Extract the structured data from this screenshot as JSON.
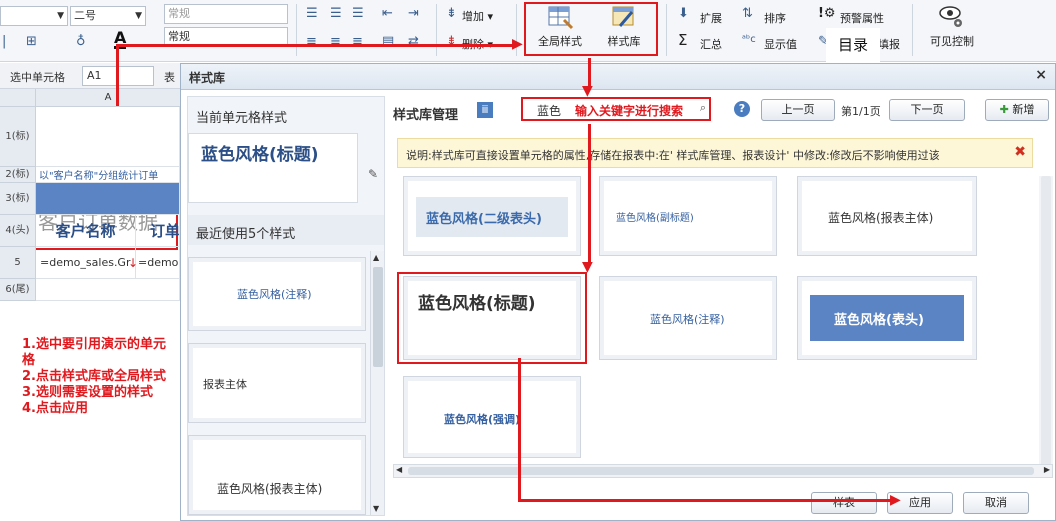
{
  "toolbar": {
    "font_size": "二号",
    "format_top": "常规",
    "format_bottom": "常规",
    "add_label": "增加",
    "delete_label": "删除",
    "global_style_label": "全局样式",
    "style_lib_label": "样式库",
    "expand_label": "扩展",
    "sort_label": "排序",
    "alert_label": "预警属性",
    "summary_label": "汇总",
    "display_label": "显示值",
    "fill_label": "填报",
    "directory_label": "目录",
    "visible_label": "可见控制"
  },
  "sheet": {
    "select_cell_label": "选中单元格",
    "cell_ref": "A1",
    "table_label": "表",
    "col_a": "A",
    "rows": [
      {
        "header": "1(标)",
        "text": "客户订单数据"
      },
      {
        "header": "2(标)",
        "text": "以\"客户名称\"分组统计订单"
      },
      {
        "header": "3(标)",
        "text": ""
      },
      {
        "header": "4(头)",
        "text": "客户名称",
        "text2": "订单"
      },
      {
        "header": "5",
        "text": "=demo_sales.Gr",
        "text2": "=demo"
      },
      {
        "header": "6(尾)",
        "text": ""
      }
    ]
  },
  "instructions": [
    "1.选中要引用演示的单元格",
    "2.点击样式库或全局样式",
    "3.选则需要设置的样式",
    "4.点击应用"
  ],
  "dialog": {
    "title": "样式库",
    "close": "×",
    "current_style_label": "当前单元格样式",
    "current_style_name": "蓝色风格(标题)",
    "recent_label": "最近使用5个样式",
    "recent": [
      "蓝色风格(注释)",
      "报表主体",
      "蓝色风格(报表主体)"
    ],
    "manage_label": "样式库管理",
    "search_value": "蓝色",
    "search_hint": "输入关键字进行搜索",
    "prev_label": "上一页",
    "page_label": "第1/1页",
    "next_label": "下一页",
    "new_label": "新增",
    "notice": "说明:样式库可直接设置单元格的属性,存储在报表中:在' 样式库管理、报表设计' 中修改:修改后不影响使用过该",
    "styles": [
      "蓝色风格(二级表头)",
      "蓝色风格(副标题)",
      "蓝色风格(报表主体)",
      "蓝色风格(标题)",
      "蓝色风格(注释)",
      "蓝色风格(表头)",
      "蓝色风格(强调)"
    ],
    "preview_label": "样表",
    "apply_label": "应用",
    "cancel_label": "取消"
  },
  "colors": {
    "accent": "#e0191e",
    "header_blue": "#5b84c4",
    "title_blue": "#2b4f86"
  }
}
